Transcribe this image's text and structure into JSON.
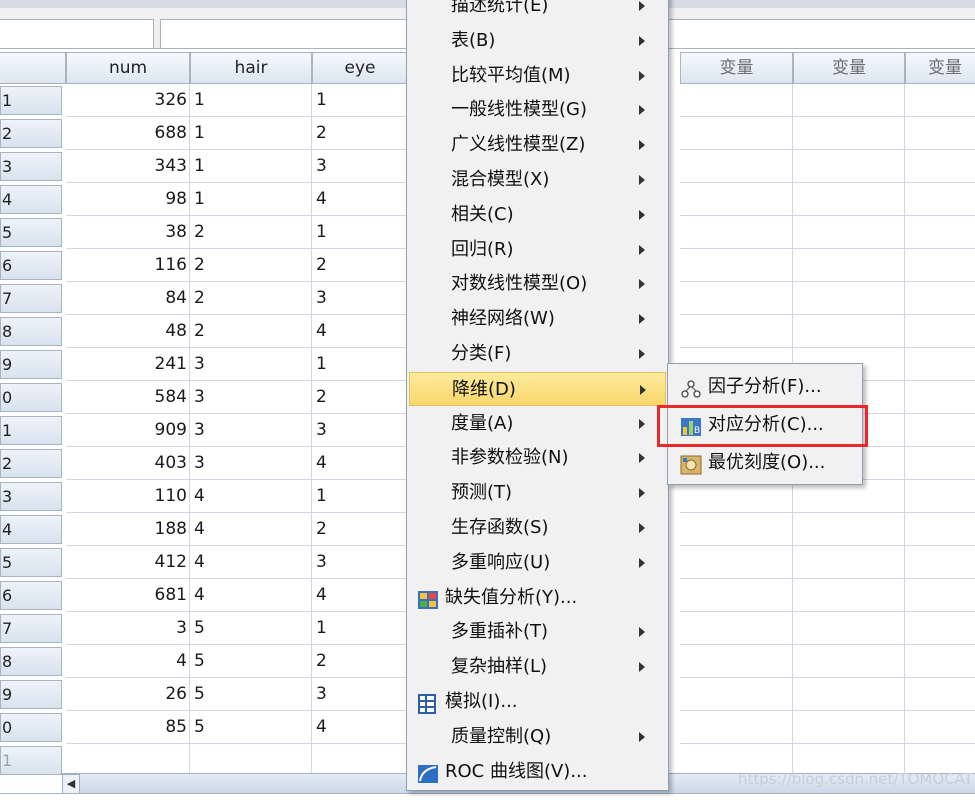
{
  "grid": {
    "headers": [
      "num",
      "hair",
      "eye",
      "变量",
      "变量",
      "变量"
    ],
    "row_numbers": [
      "1",
      "2",
      "3",
      "4",
      "5",
      "6",
      "7",
      "8",
      "9",
      "0",
      "1",
      "2",
      "3",
      "4",
      "5",
      "6",
      "7",
      "8",
      "9",
      "0",
      "1"
    ],
    "rows": [
      [
        "326",
        "1",
        "1"
      ],
      [
        "688",
        "1",
        "2"
      ],
      [
        "343",
        "1",
        "3"
      ],
      [
        "98",
        "1",
        "4"
      ],
      [
        "38",
        "2",
        "1"
      ],
      [
        "116",
        "2",
        "2"
      ],
      [
        "84",
        "2",
        "3"
      ],
      [
        "48",
        "2",
        "4"
      ],
      [
        "241",
        "3",
        "1"
      ],
      [
        "584",
        "3",
        "2"
      ],
      [
        "909",
        "3",
        "3"
      ],
      [
        "403",
        "3",
        "4"
      ],
      [
        "110",
        "4",
        "1"
      ],
      [
        "188",
        "4",
        "2"
      ],
      [
        "412",
        "4",
        "3"
      ],
      [
        "681",
        "4",
        "4"
      ],
      [
        "3",
        "5",
        "1"
      ],
      [
        "4",
        "5",
        "2"
      ],
      [
        "26",
        "5",
        "3"
      ],
      [
        "85",
        "5",
        "4"
      ]
    ]
  },
  "analyze_menu": {
    "items": [
      {
        "label": "描述统计(E)",
        "submenu": true
      },
      {
        "label": "表(B)",
        "submenu": true
      },
      {
        "label": "比较平均值(M)",
        "submenu": true
      },
      {
        "label": "一般线性模型(G)",
        "submenu": true
      },
      {
        "label": "广义线性模型(Z)",
        "submenu": true
      },
      {
        "label": "混合模型(X)",
        "submenu": true
      },
      {
        "label": "相关(C)",
        "submenu": true
      },
      {
        "label": "回归(R)",
        "submenu": true
      },
      {
        "label": "对数线性模型(O)",
        "submenu": true
      },
      {
        "label": "神经网络(W)",
        "submenu": true
      },
      {
        "label": "分类(F)",
        "submenu": true
      },
      {
        "label": "降维(D)",
        "submenu": true,
        "active": true
      },
      {
        "label": "度量(A)",
        "submenu": true
      },
      {
        "label": "非参数检验(N)",
        "submenu": true
      },
      {
        "label": "预测(T)",
        "submenu": true
      },
      {
        "label": "生存函数(S)",
        "submenu": true
      },
      {
        "label": "多重响应(U)",
        "submenu": true
      },
      {
        "label": "缺失值分析(Y)...",
        "submenu": false,
        "icon": "missing-values-icon"
      },
      {
        "label": "多重插补(T)",
        "submenu": true
      },
      {
        "label": "复杂抽样(L)",
        "submenu": true
      },
      {
        "label": "模拟(I)...",
        "submenu": false,
        "icon": "simulation-icon"
      },
      {
        "label": "质量控制(Q)",
        "submenu": true
      },
      {
        "label": "ROC 曲线图(V)...",
        "submenu": false,
        "icon": "roc-curve-icon"
      }
    ]
  },
  "dimension_reduction_submenu": {
    "items": [
      {
        "label": "因子分析(F)...",
        "icon": "factor-analysis-icon"
      },
      {
        "label": "对应分析(C)...",
        "icon": "correspondence-analysis-icon",
        "highlighted": true
      },
      {
        "label": "最优刻度(O)...",
        "icon": "optimal-scaling-icon"
      }
    ]
  },
  "watermark": "https://blog.csdn.net/TOMOCAT",
  "colors": {
    "highlight_box": "#e8282a",
    "active_item": "#f8d66a"
  }
}
